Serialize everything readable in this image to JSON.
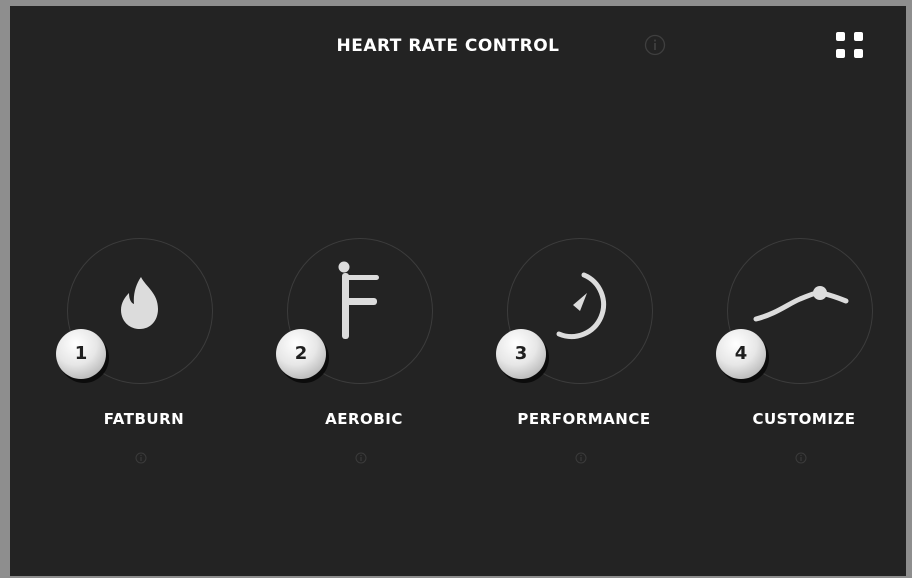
{
  "header": {
    "title": "HEART RATE CONTROL"
  },
  "icons": {
    "info": "info-icon",
    "menu": "grid-menu-icon"
  },
  "modes": [
    {
      "number": "1",
      "label": "FATBURN",
      "icon": "flame-icon"
    },
    {
      "number": "2",
      "label": "AEROBIC",
      "icon": "exercise-figure-icon"
    },
    {
      "number": "3",
      "label": "PERFORMANCE",
      "icon": "gauge-icon"
    },
    {
      "number": "4",
      "label": "CUSTOMIZE",
      "icon": "custom-curve-icon"
    }
  ],
  "colors": {
    "background": "#232323",
    "frame": "#8e8e8e",
    "icon": "#d9d9d9",
    "ring": "#3c3c3c"
  }
}
